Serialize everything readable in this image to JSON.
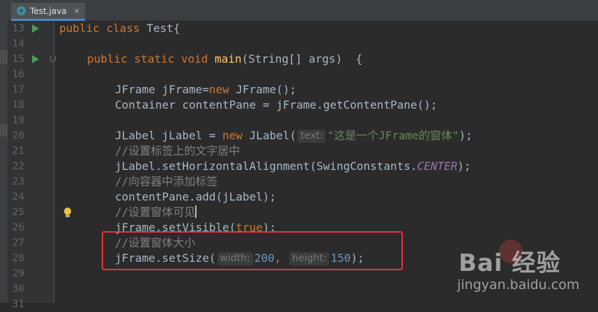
{
  "tab": {
    "label": "Test.java",
    "close": "×",
    "icon": "java-class-icon"
  },
  "colors": {
    "accent": "#4a88c7",
    "highlight_box": "#e8353a",
    "run_icon": "#499c54"
  },
  "lines": [
    {
      "num": "13",
      "run": true,
      "fold": false,
      "bulb": false
    },
    {
      "num": "14",
      "run": false,
      "fold": false,
      "bulb": false
    },
    {
      "num": "15",
      "run": true,
      "fold": true,
      "bulb": false
    },
    {
      "num": "16",
      "run": false,
      "fold": false,
      "bulb": false
    },
    {
      "num": "17",
      "run": false,
      "fold": false,
      "bulb": false
    },
    {
      "num": "18",
      "run": false,
      "fold": false,
      "bulb": false
    },
    {
      "num": "19",
      "run": false,
      "fold": false,
      "bulb": false
    },
    {
      "num": "20",
      "run": false,
      "fold": false,
      "bulb": false
    },
    {
      "num": "21",
      "run": false,
      "fold": false,
      "bulb": false
    },
    {
      "num": "22",
      "run": false,
      "fold": false,
      "bulb": false
    },
    {
      "num": "23",
      "run": false,
      "fold": false,
      "bulb": false
    },
    {
      "num": "24",
      "run": false,
      "fold": false,
      "bulb": false
    },
    {
      "num": "25",
      "run": false,
      "fold": false,
      "bulb": true
    },
    {
      "num": "26",
      "run": false,
      "fold": false,
      "bulb": false
    },
    {
      "num": "27",
      "run": false,
      "fold": false,
      "bulb": false
    },
    {
      "num": "28",
      "run": false,
      "fold": false,
      "bulb": false
    },
    {
      "num": "29",
      "run": false,
      "fold": false,
      "bulb": false
    },
    {
      "num": "30",
      "run": false,
      "fold": false,
      "bulb": false
    },
    {
      "num": "31",
      "run": false,
      "fold": false,
      "bulb": false
    }
  ],
  "code": {
    "l13": {
      "kw1": "public",
      "kw2": "class",
      "name": "Test",
      "brace": "{"
    },
    "l15": {
      "kw1": "public",
      "kw2": "static",
      "kw3": "void",
      "fn": "main",
      "params": "(String[] args)",
      "brace": "{"
    },
    "l17": {
      "pre": "JFrame jFrame=",
      "kw": "new",
      "post": "JFrame();"
    },
    "l18": {
      "text": "Container contentPane = jFrame.getContentPane();"
    },
    "l20": {
      "pre": "JLabel jLabel = ",
      "kw": "new",
      "mid": "JLabel(",
      "hint": "text:",
      "str": "\"这是一个JFrame的窗体\"",
      "post": ");"
    },
    "l21": {
      "comment": "//设置标签上的文字居中"
    },
    "l22": {
      "pre": "jLabel.setHorizontalAlignment(SwingConstants.",
      "field": "CENTER",
      "post": ");"
    },
    "l23": {
      "comment": "//向容器中添加标签"
    },
    "l24": {
      "text": "contentPane.add(jLabel);"
    },
    "l25": {
      "comment": "//设置窗体可见"
    },
    "l26": {
      "pre": "jFrame.setVisible(",
      "kw": "true",
      "post": ");"
    },
    "l27": {
      "comment": "//设置窗体大小"
    },
    "l28": {
      "pre": "jFrame.setSize(",
      "hint1": "width:",
      "num1": "200",
      "sep": ",",
      "hint2": "height:",
      "num2": "150",
      "post": ");"
    }
  },
  "watermark": {
    "brand": "Bai  经验",
    "url": "jingyan.baidu.com",
    "icon": "baidu-paw-icon"
  }
}
